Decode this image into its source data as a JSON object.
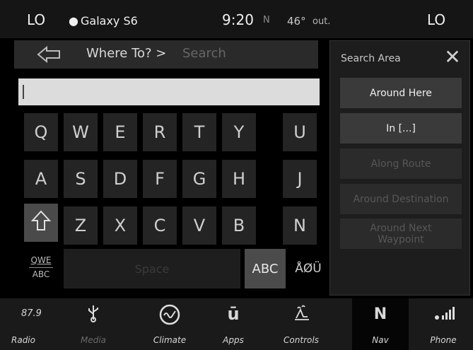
{
  "status": {
    "temp_left": "LO",
    "device": "Galaxy S6",
    "time": "9:20",
    "compass": "N",
    "outside_temp": "46°",
    "outside_unit": "out.",
    "temp_right": "LO"
  },
  "nav": {
    "title": "Where To? >",
    "search_placeholder": "Search"
  },
  "keyboard": {
    "row1": [
      "Q",
      "W",
      "E",
      "R",
      "T",
      "Y",
      "U"
    ],
    "row2": [
      "A",
      "S",
      "D",
      "F",
      "G",
      "H",
      "J"
    ],
    "row3": [
      "Z",
      "X",
      "C",
      "V",
      "B",
      "N"
    ],
    "mode_top": "QWE",
    "mode_bottom": "ABC",
    "space": "Space",
    "abc": "ABC",
    "special": "ÅØÜ"
  },
  "panel": {
    "title": "Search Area",
    "options": [
      {
        "label": "Around Here",
        "enabled": true
      },
      {
        "label": "In [...]",
        "enabled": true
      },
      {
        "label": "Along Route",
        "enabled": false
      },
      {
        "label": "Around Destination",
        "enabled": false
      },
      {
        "label": "Around Next Waypoint",
        "enabled": false
      }
    ]
  },
  "bottom": {
    "radio_freq": "87.9",
    "tabs": [
      {
        "label": "Radio",
        "icon": "radio-icon",
        "enabled": true
      },
      {
        "label": "Media",
        "icon": "usb-icon",
        "enabled": false
      },
      {
        "label": "Climate",
        "icon": "climate-icon",
        "enabled": true
      },
      {
        "label": "Apps",
        "icon": "apps-icon",
        "enabled": true
      },
      {
        "label": "Controls",
        "icon": "controls-icon",
        "enabled": true
      },
      {
        "label": "Nav",
        "icon": "compass-icon",
        "enabled": true
      },
      {
        "label": "Phone",
        "icon": "phone-signal-icon",
        "enabled": true
      }
    ],
    "nav_letter": "N"
  }
}
